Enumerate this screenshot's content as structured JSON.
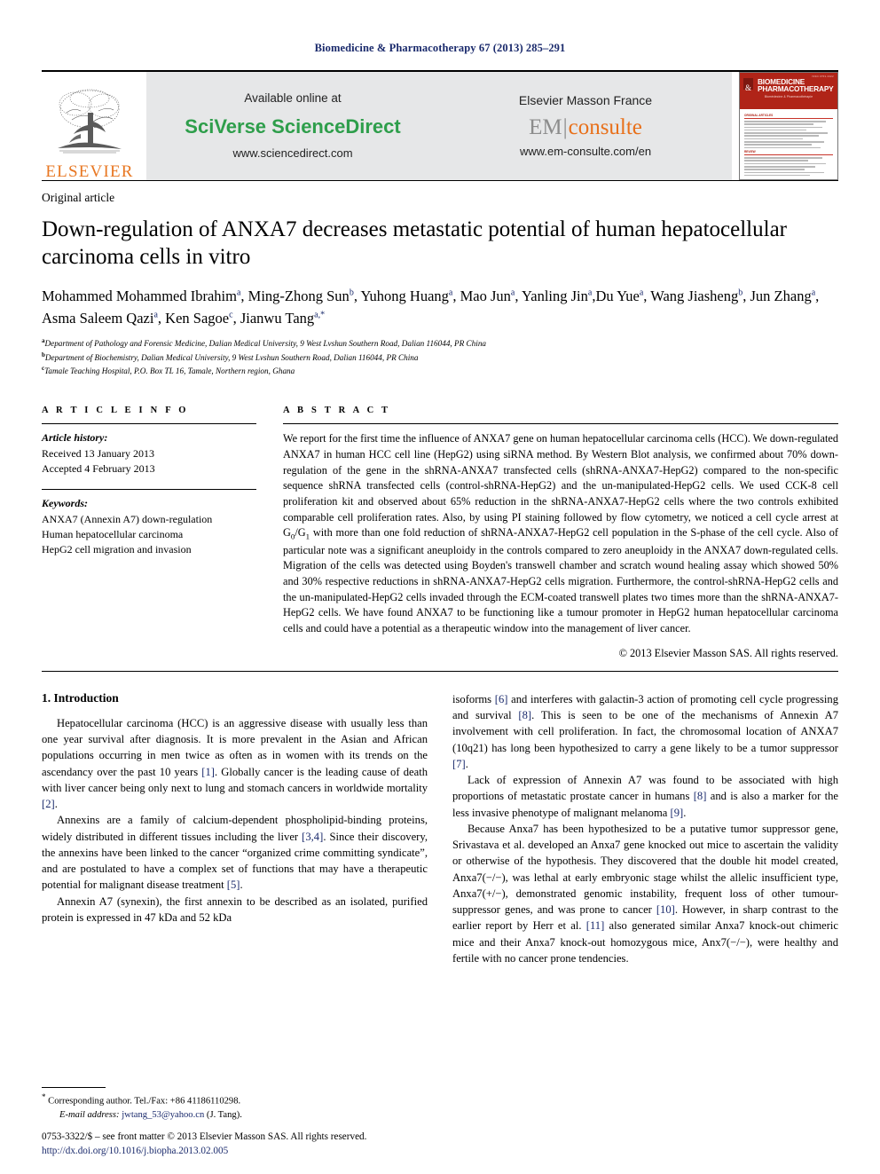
{
  "running_head": "Biomedicine & Pharmacotherapy 67 (2013) 285–291",
  "masthead": {
    "publisher_logo_text": "ELSEVIER",
    "available_online": "Available online at",
    "platform_name_part1": "SciVerse ",
    "platform_name_part2": "ScienceDirect",
    "platform_url": "www.sciencedirect.com",
    "masson_line": "Elsevier Masson France",
    "emconsulte_em": "EM",
    "emconsulte_bar": "|",
    "emconsulte_consulte": "consulte",
    "emconsulte_url": "www.em-consulte.com/en",
    "cover": {
      "issn_line": "ISSN 0753-3322",
      "title_line1": "BIOMEDICINE",
      "title_line2": "PHARMACOTHERAPY",
      "ampersand": "&",
      "subtitle": "Biomédecine & Pharmacothérapie",
      "section1": "ORIGINAL ARTICLES",
      "section2": "REVIEW"
    },
    "colors": {
      "elsevier_orange": "#E87722",
      "sciencedirect_green": "#2e9e4b",
      "consulte_orange": "#E8701A",
      "cover_red": "#b02418",
      "navy": "#1a2a6c"
    }
  },
  "article": {
    "type": "Original article",
    "title": "Down-regulation of ANXA7 decreases metastatic potential of human hepatocellular carcinoma cells in vitro",
    "authors": [
      {
        "name": "Mohammed Mohammed Ibrahim",
        "sup": "a",
        "sep": ", "
      },
      {
        "name": "Ming-Zhong Sun",
        "sup": "b",
        "sep": ", "
      },
      {
        "name": "Yuhong Huang",
        "sup": "a",
        "sep": ", "
      },
      {
        "name": "Mao Jun",
        "sup": "a",
        "sep": ", "
      },
      {
        "name": "Yanling Jin",
        "sup": "a",
        "sep": ","
      },
      {
        "name": "Du Yue",
        "sup": "a",
        "sep": ", "
      },
      {
        "name": "Wang Jiasheng",
        "sup": "b",
        "sep": ", "
      },
      {
        "name": "Jun Zhang",
        "sup": "a",
        "sep": ", "
      },
      {
        "name": "Asma Saleem Qazi",
        "sup": "a",
        "sep": ", "
      },
      {
        "name": "Ken Sagoe",
        "sup": "c",
        "sep": ", "
      },
      {
        "name": "Jianwu Tang",
        "sup": "a,*",
        "sep": ""
      }
    ],
    "affiliations": [
      {
        "mark": "a",
        "text": "Department of Pathology and Forensic Medicine, Dalian Medical University, 9 West Lvshun Southern Road, Dalian 116044, PR China"
      },
      {
        "mark": "b",
        "text": "Department of Biochemistry, Dalian Medical University, 9 West Lvshun Southern Road, Dalian 116044, PR China"
      },
      {
        "mark": "c",
        "text": "Tamale Teaching Hospital, P.O. Box TL 16, Tamale, Northern region, Ghana"
      }
    ]
  },
  "article_info": {
    "heading": "A R T I C L E  I N F O",
    "history_label": "Article history:",
    "history": [
      "Received 13 January 2013",
      "Accepted 4 February 2013"
    ],
    "keywords_label": "Keywords:",
    "keywords": [
      "ANXA7 (Annexin A7) down-regulation",
      "Human hepatocellular carcinoma",
      "HepG2 cell migration and invasion"
    ]
  },
  "abstract": {
    "heading": "A B S T R A C T",
    "text_part1": "We report for the first time the influence of ANXA7 gene on human hepatocellular carcinoma cells (HCC). We down-regulated ANXA7 in human HCC cell line (HepG2) using siRNA method. By Western Blot analysis, we confirmed about 70% down-regulation of the gene in the shRNA-ANXA7 transfected cells (shRNA-ANXA7-HepG2) compared to the non-specific sequence shRNA transfected cells (control-shRNA-HepG2) and the un-manipulated-HepG2 cells. We used CCK-8 cell proliferation kit and observed about 65% reduction in the shRNA-ANXA7-HepG2 cells where the two controls exhibited comparable cell proliferation rates. Also, by using PI staining followed by flow cytometry, we noticed a cell cycle arrest at G",
    "subscript1": "0",
    "slash": "/G",
    "subscript2": "1",
    "text_part2": " with more than one fold reduction of shRNA-ANXA7-HepG2 cell population in the S-phase of the cell cycle. Also of particular note was a significant aneuploidy in the controls compared to zero aneuploidy in the ANXA7 down-regulated cells. Migration of the cells was detected using Boyden's transwell chamber and scratch wound healing assay which showed 50% and 30% respective reductions in shRNA-ANXA7-HepG2 cells migration. Furthermore, the control-shRNA-HepG2 cells and the un-manipulated-HepG2 cells invaded through the ECM-coated transwell plates two times more than the shRNA-ANXA7-HepG2 cells. We have found ANXA7 to be functioning like a tumour promoter in HepG2 human hepatocellular carcinoma cells and could have a potential as a therapeutic window into the management of liver cancer.",
    "copyright": "© 2013 Elsevier Masson SAS. All rights reserved."
  },
  "introduction": {
    "heading": "1. Introduction",
    "left_paragraphs": [
      {
        "p1": "Hepatocellular carcinoma (HCC) is an aggressive disease with usually less than one year survival after diagnosis. It is more prevalent in the Asian and African populations occurring in men twice as often as in women with its trends on the ascendancy over the past 10 years ",
        "r1": "[1]",
        "p2": ". Globally cancer is the leading cause of death with liver cancer being only next to lung and stomach cancers in worldwide mortality ",
        "r2": "[2]",
        "p3": "."
      },
      {
        "p1": "Annexins are a family of calcium-dependent phospholipid-binding proteins, widely distributed in different tissues including the liver ",
        "r1": "[3,4]",
        "p2": ". Since their discovery, the annexins have been linked to the cancer “organized crime committing syndicate”, and are postulated to have a complex set of functions that may have a therapeutic potential for malignant disease treatment ",
        "r2": "[5]",
        "p3": "."
      },
      {
        "p1": "Annexin A7 (synexin), the first annexin to be described as an isolated, purified protein is expressed in 47 kDa and 52 kDa",
        "r1": "",
        "p2": "",
        "r2": "",
        "p3": ""
      }
    ],
    "right_paragraphs": [
      {
        "p1": "isoforms ",
        "r1": "[6]",
        "p2": " and interferes with galactin-3 action of promoting cell cycle progressing and survival ",
        "r2": "[8]",
        "p3": ". This is seen to be one of the mechanisms of Annexin A7 involvement with cell proliferation. In fact, the chromosomal location of ANXA7 (10q21) has long been hypothesized to carry a gene likely to be a tumor suppressor ",
        "r3": "[7]",
        "p4": "."
      },
      {
        "p1": "Lack of expression of Annexin A7 was found to be associated with high proportions of metastatic prostate cancer in humans ",
        "r1": "[8]",
        "p2": " and is also a marker for the less invasive phenotype of malignant melanoma ",
        "r2": "[9]",
        "p3": ".",
        "r3": "",
        "p4": ""
      },
      {
        "p1": "Because Anxa7 has been hypothesized to be a putative tumor suppressor gene, Srivastava et al. developed an Anxa7 gene knocked out mice to ascertain the validity or otherwise of the hypothesis. They discovered that the double hit model created, Anxa7(−/−), was lethal at early embryonic stage whilst the allelic insufficient type, Anxa7(+/−), demonstrated genomic instability, frequent loss of other tumour-suppressor genes, and was prone to cancer ",
        "r1": "[10]",
        "p2": ". However, in sharp contrast to the earlier report by Herr et al. ",
        "r2": "[11]",
        "p3": " also generated similar Anxa7 knock-out chimeric mice and their Anxa7 knock-out homozygous mice, Anx7(−/−), were healthy and fertile with no cancer prone tendencies.",
        "r3": "",
        "p4": ""
      }
    ]
  },
  "footnotes": {
    "corresponding_marker": "*",
    "corresponding_text": "Corresponding author. Tel./Fax: +86 41186110298.",
    "email_label": "E-mail address:",
    "email": "jwtang_53@yahoo.cn",
    "email_owner": "(J. Tang).",
    "imprint": "0753-3322/$ – see front matter © 2013 Elsevier Masson SAS. All rights reserved.",
    "doi": "http://dx.doi.org/10.1016/j.biopha.2013.02.005"
  }
}
